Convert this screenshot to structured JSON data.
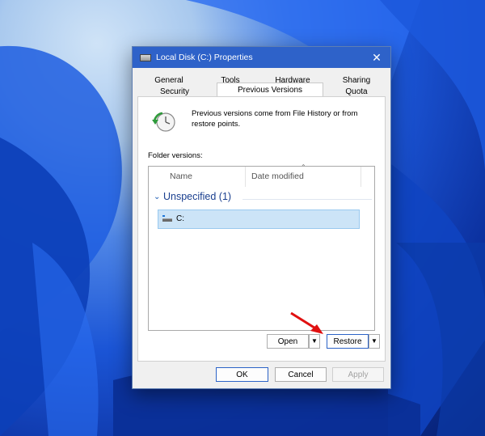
{
  "dialog": {
    "title": "Local Disk (C:) Properties",
    "close_icon": "close-icon",
    "tabs_row1": [
      "General",
      "Tools",
      "Hardware",
      "Sharing"
    ],
    "tabs_row2": [
      "Security",
      "Previous Versions",
      "Quota"
    ],
    "active_tab": "Previous Versions"
  },
  "panel": {
    "info_text": "Previous versions come from File History or from restore points.",
    "folder_versions_label": "Folder versions:",
    "columns": [
      "Name",
      "Date modified"
    ],
    "group": {
      "label": "Unspecified (1)"
    },
    "items": [
      {
        "name": "C:",
        "selected": true
      }
    ]
  },
  "buttons": {
    "open": "Open",
    "restore": "Restore",
    "ok": "OK",
    "cancel": "Cancel",
    "apply": "Apply"
  },
  "colors": {
    "titlebar": "#2e62c9",
    "selection": "#cce4f7",
    "arrow": "#e01010"
  }
}
